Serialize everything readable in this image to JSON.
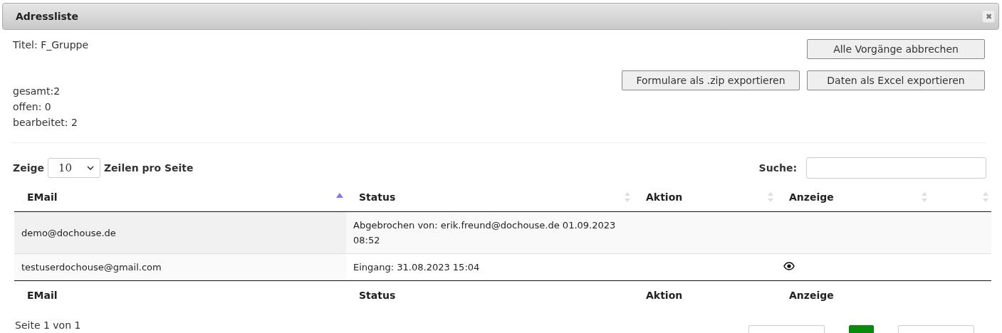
{
  "window": {
    "title": "Adressliste",
    "close": "✖"
  },
  "info": {
    "title": "Titel: F_Gruppe",
    "stats": [
      "gesamt:2",
      "offen: 0",
      "bearbeitet: 2"
    ]
  },
  "buttons": [
    {
      "label": "Alle Vorgänge abbrechen"
    },
    {
      "label": "Formulare als .zip exportieren"
    },
    {
      "label": "Daten als Excel exportieren"
    }
  ],
  "length": {
    "before": "Zeige",
    "value": "10",
    "after": "Zeilen pro Seite"
  },
  "search": {
    "label": "Suche:"
  },
  "table": {
    "columns": [
      {
        "label": "EMail",
        "sorted": true
      },
      {
        "label": "Status",
        "sorted": false
      },
      {
        "label": "Aktion",
        "sorted": false
      },
      {
        "label": "Anzeige",
        "sorted": false
      },
      {
        "sorted": false
      }
    ],
    "rows": [
      {
        "cells": [
          "demo@dochouse.de",
          "Abgebrochen von: erik.freund@dochouse.de 01.09.2023 08:52"
        ],
        "view": false
      },
      {
        "cells": [
          "testuserdochouse@gmail.com",
          "Eingang: 31.08.2023 15:04"
        ],
        "view": true
      }
    ],
    "footer": [
      "EMail",
      "Status",
      "Aktion",
      "Anzeige"
    ]
  },
  "page_info": "Seite 1 von 1",
  "pagination": [
    {
      "selected": false
    },
    {
      "selected": true
    },
    {
      "selected": false
    }
  ]
}
